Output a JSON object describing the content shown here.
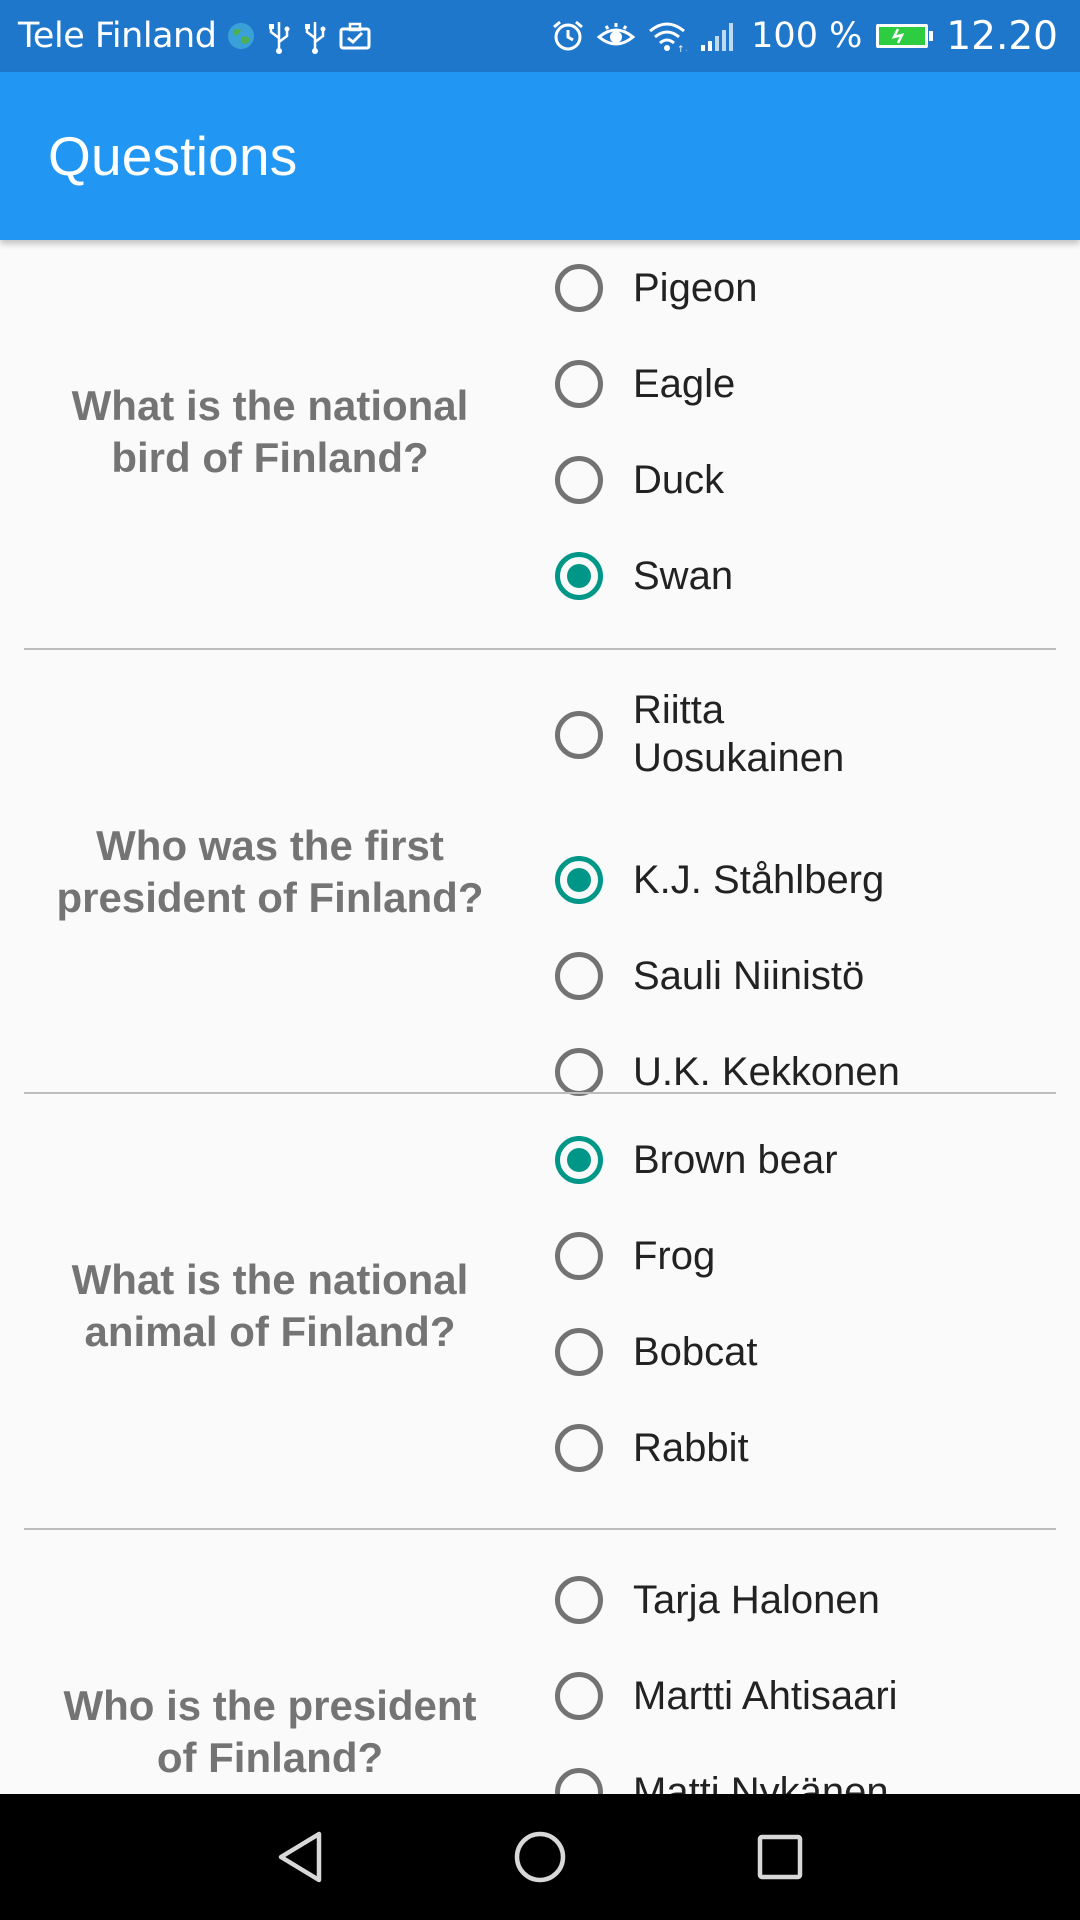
{
  "status_bar": {
    "carrier": "Tele Finland",
    "battery": "100 %",
    "time": "12.20",
    "icons_left": [
      "globe-icon",
      "usb-icon",
      "usb-icon",
      "briefcase-icon"
    ],
    "icons_right": [
      "alarm-icon",
      "eye-icon",
      "wifi-icon",
      "signal-icon",
      "battery-icon"
    ]
  },
  "app_bar": {
    "title": "Questions"
  },
  "colors": {
    "status_bar": "#1f77cc",
    "app_bar": "#2196f3",
    "accent": "#009688",
    "question_text": "#747474",
    "option_text": "#222222"
  },
  "questions": [
    {
      "text": "What is the national bird of Finland?",
      "options": [
        {
          "label": "Pigeon",
          "checked": false
        },
        {
          "label": "Eagle",
          "checked": false
        },
        {
          "label": "Duck",
          "checked": false
        },
        {
          "label": "Swan",
          "checked": true
        }
      ]
    },
    {
      "text": "Who was the first president of Finland?",
      "options": [
        {
          "label": "Riitta Uosukainen",
          "checked": false
        },
        {
          "label": "K.J. Ståhlberg",
          "checked": true
        },
        {
          "label": "Sauli Niinistö",
          "checked": false
        },
        {
          "label": "U.K. Kekkonen",
          "checked": false
        }
      ]
    },
    {
      "text": "What is the national animal of Finland?",
      "options": [
        {
          "label": "Brown bear",
          "checked": true
        },
        {
          "label": "Frog",
          "checked": false
        },
        {
          "label": "Bobcat",
          "checked": false
        },
        {
          "label": "Rabbit",
          "checked": false
        }
      ]
    },
    {
      "text": "Who is the president of Finland?",
      "options": [
        {
          "label": "Tarja Halonen",
          "checked": false
        },
        {
          "label": "Martti Ahtisaari",
          "checked": false
        },
        {
          "label": "Matti Nykänen",
          "checked": false
        }
      ]
    }
  ],
  "nav_bar": {
    "buttons": [
      "back-icon",
      "home-icon",
      "recents-icon"
    ]
  }
}
